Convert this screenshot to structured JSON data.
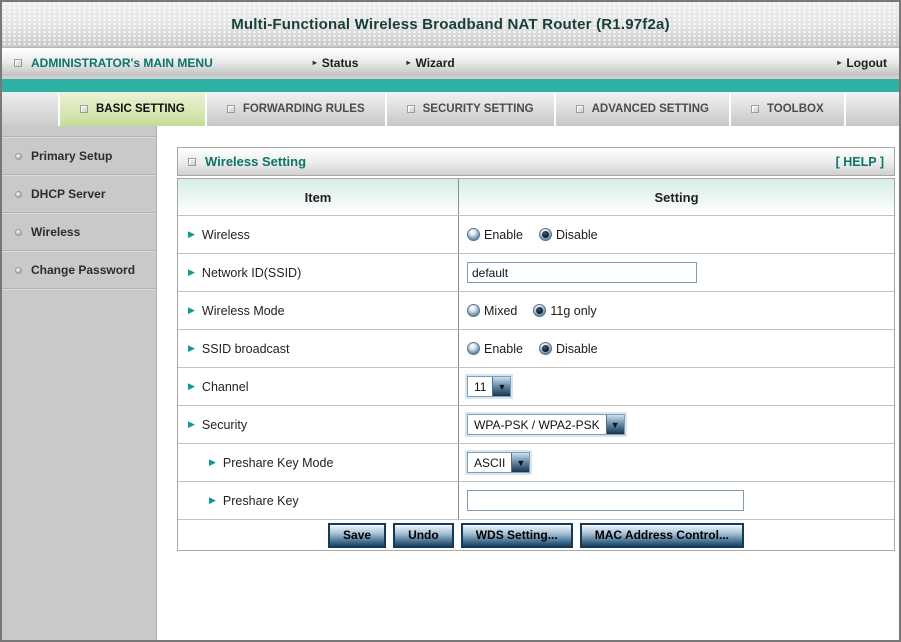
{
  "window": {
    "title": "Multi-Functional Wireless Broadband NAT Router (R1.97f2a)"
  },
  "menubar": {
    "main_menu": "ADMINISTRATOR's MAIN MENU",
    "status": "Status",
    "wizard": "Wizard",
    "logout": "Logout",
    "arrow_glyph": "▸"
  },
  "tabs": {
    "items": [
      {
        "label": "BASIC SETTING",
        "active": true
      },
      {
        "label": "FORWARDING RULES",
        "active": false
      },
      {
        "label": "SECURITY SETTING",
        "active": false
      },
      {
        "label": "ADVANCED SETTING",
        "active": false
      },
      {
        "label": "TOOLBOX",
        "active": false
      }
    ]
  },
  "sidebar": {
    "items": [
      {
        "label": "Primary Setup"
      },
      {
        "label": "DHCP Server"
      },
      {
        "label": "Wireless"
      },
      {
        "label": "Change Password"
      }
    ]
  },
  "panel": {
    "title": "Wireless Setting",
    "help_label": "[ HELP ]",
    "columns": {
      "item": "Item",
      "setting": "Setting"
    },
    "row_arrow_glyph": "▶",
    "rows": [
      {
        "label": "Wireless",
        "type": "radio",
        "options": [
          {
            "label": "Enable",
            "selected": false
          },
          {
            "label": "Disable",
            "selected": true
          }
        ]
      },
      {
        "label": "Network ID(SSID)",
        "type": "text",
        "value": "default"
      },
      {
        "label": "Wireless Mode",
        "type": "radio",
        "options": [
          {
            "label": "Mixed",
            "selected": false
          },
          {
            "label": "11g only",
            "selected": true
          }
        ]
      },
      {
        "label": "SSID broadcast",
        "type": "radio",
        "options": [
          {
            "label": "Enable",
            "selected": false
          },
          {
            "label": "Disable",
            "selected": true
          }
        ]
      },
      {
        "label": "Channel",
        "type": "select",
        "value": "11"
      },
      {
        "label": "Security",
        "type": "select",
        "value": "WPA-PSK / WPA2-PSK"
      },
      {
        "label": "Preshare Key Mode",
        "type": "select",
        "value": "ASCII",
        "indent": true
      },
      {
        "label": "Preshare Key",
        "type": "text",
        "value": "",
        "indent": true
      }
    ],
    "buttons": [
      {
        "label": "Save"
      },
      {
        "label": "Undo"
      },
      {
        "label": "WDS Setting..."
      },
      {
        "label": "MAC Address Control..."
      }
    ],
    "dropdown_arrow_glyph": "▼"
  },
  "colors": {
    "teal_band": "#2eb1a4",
    "accent_teal_text": "#0b7668",
    "title_text": "#173f3a",
    "active_tab_green": "#d9e8b4",
    "button_border_navy": "#143a56"
  }
}
